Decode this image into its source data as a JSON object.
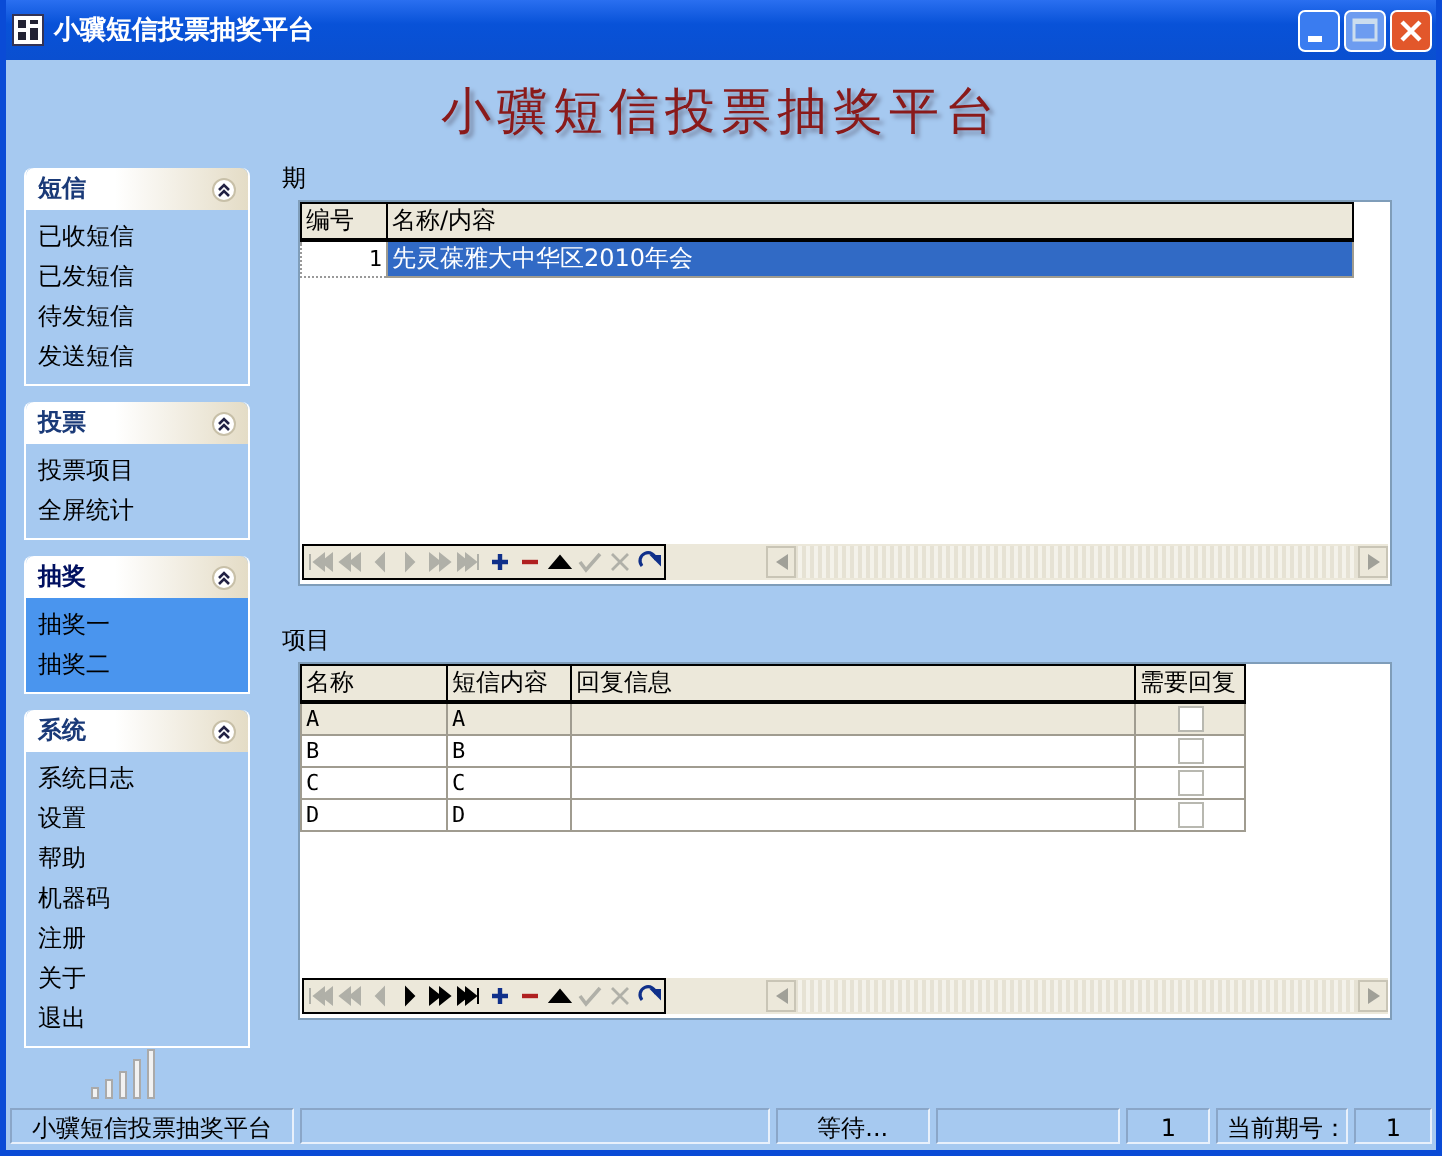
{
  "window": {
    "title": "小骥短信投票抽奖平台"
  },
  "banner": {
    "title": "小骥短信投票抽奖平台"
  },
  "sidebar": {
    "groups": [
      {
        "title": "短信",
        "expanded": true,
        "selected": false,
        "items": [
          "已收短信",
          "已发短信",
          "待发短信",
          "发送短信"
        ]
      },
      {
        "title": "投票",
        "expanded": true,
        "selected": false,
        "items": [
          "投票项目",
          "全屏统计"
        ]
      },
      {
        "title": "抽奖",
        "expanded": true,
        "selected": true,
        "items": [
          "抽奖一",
          "抽奖二"
        ]
      },
      {
        "title": "系统",
        "expanded": true,
        "selected": false,
        "items": [
          "系统日志",
          "设置",
          "帮助",
          "机器码",
          "注册",
          "关于",
          "退出"
        ]
      }
    ]
  },
  "periods": {
    "label": "期",
    "columns": [
      "编号",
      "名称/内容"
    ],
    "rows": [
      {
        "cells": [
          "1",
          "先灵葆雅大中华区2010年会"
        ],
        "selected": true
      }
    ],
    "navigator": [
      {
        "kind": "first",
        "disabled": true
      },
      {
        "kind": "prior-page",
        "disabled": true
      },
      {
        "kind": "prior",
        "disabled": true
      },
      {
        "kind": "next",
        "disabled": true
      },
      {
        "kind": "next-page",
        "disabled": true
      },
      {
        "kind": "last",
        "disabled": true
      },
      {
        "kind": "insert",
        "disabled": false
      },
      {
        "kind": "delete",
        "disabled": false
      },
      {
        "kind": "edit",
        "disabled": false
      },
      {
        "kind": "post",
        "disabled": true
      },
      {
        "kind": "cancel",
        "disabled": true
      },
      {
        "kind": "refresh",
        "disabled": false
      }
    ]
  },
  "items": {
    "label": "项目",
    "columns": [
      "名称",
      "短信内容",
      "回复信息",
      "需要回复"
    ],
    "rows": [
      {
        "cells": [
          "A",
          "A",
          ""
        ],
        "checked": false,
        "selected": true
      },
      {
        "cells": [
          "B",
          "B",
          ""
        ],
        "checked": false,
        "selected": false
      },
      {
        "cells": [
          "C",
          "C",
          ""
        ],
        "checked": false,
        "selected": false
      },
      {
        "cells": [
          "D",
          "D",
          ""
        ],
        "checked": false,
        "selected": false
      }
    ],
    "navigator": [
      {
        "kind": "first",
        "disabled": true
      },
      {
        "kind": "prior-page",
        "disabled": true
      },
      {
        "kind": "prior",
        "disabled": true
      },
      {
        "kind": "next",
        "disabled": false
      },
      {
        "kind": "next-page",
        "disabled": false
      },
      {
        "kind": "last",
        "disabled": false
      },
      {
        "kind": "insert",
        "disabled": false
      },
      {
        "kind": "delete",
        "disabled": false
      },
      {
        "kind": "edit",
        "disabled": false
      },
      {
        "kind": "post",
        "disabled": true
      },
      {
        "kind": "cancel",
        "disabled": true
      },
      {
        "kind": "refresh",
        "disabled": false
      }
    ]
  },
  "status_bar": [
    {
      "kind": "text",
      "text": "小骥短信投票抽奖平台"
    },
    {
      "kind": "blank"
    },
    {
      "kind": "text",
      "text": "等待..."
    },
    {
      "kind": "blank"
    },
    {
      "kind": "text",
      "text": "1"
    },
    {
      "kind": "text",
      "text": "当前期号："
    },
    {
      "kind": "text",
      "text": "1"
    }
  ]
}
